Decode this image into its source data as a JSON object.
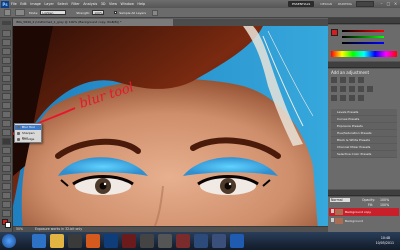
{
  "menubar": {
    "app_logo": "Ps",
    "menus": [
      "File",
      "Edit",
      "Image",
      "Layer",
      "Select",
      "Filter",
      "Analysis",
      "3D",
      "View",
      "Window",
      "Help"
    ],
    "workspaces": [
      "ESSENTIALS",
      "DESIGN",
      "PAINTING"
    ],
    "active_workspace": "ESSENTIALS"
  },
  "options": {
    "mode_label": "Mode:",
    "mode_value": "Lighten",
    "strength_label": "Strength:",
    "strength_value": "100%",
    "sample_all_label": "Sample All Layers"
  },
  "document": {
    "tab_title": "IMG_5849_2 (Uniformed_1_gray @ 100% (Background copy, RGB/8)) *",
    "zoom": "50%",
    "status_text": "Exposure works in 32-bit only"
  },
  "annotation": {
    "text": "blur tool",
    "color": "#e8162b"
  },
  "flyout": {
    "items": [
      "Blur Tool",
      "Sharpen Tool",
      "Smudge Tool"
    ],
    "shortcut": "R"
  },
  "panels": {
    "color_tab": "COLOR",
    "swatches_tab": "SWATCHES",
    "styles_tab": "STYLES",
    "adjustments_tab": "ADJUSTMENTS",
    "masks_tab": "MASKS",
    "adjustments_title": "Add an adjustment",
    "presets": [
      "Levels Presets",
      "Curves Presets",
      "Exposure Presets",
      "Hue/Saturation Presets",
      "Black & White Presets",
      "Channel Mixer Presets",
      "Selective Color Presets"
    ],
    "layers_tab": "LAYERS",
    "channels_tab": "CHANNELS",
    "paths_tab": "PATHS",
    "blend_mode": "Normal",
    "opacity_label": "Opacity:",
    "opacity_value": "100%",
    "fill_label": "Fill:",
    "fill_value": "100%",
    "layers": [
      "Background copy",
      "Background"
    ]
  },
  "taskbar": {
    "time": "10:48",
    "date": "10/05/2011"
  },
  "colors": {
    "foreground": "#d0201f",
    "background": "#ffffff",
    "accent": "#3d79c9"
  }
}
